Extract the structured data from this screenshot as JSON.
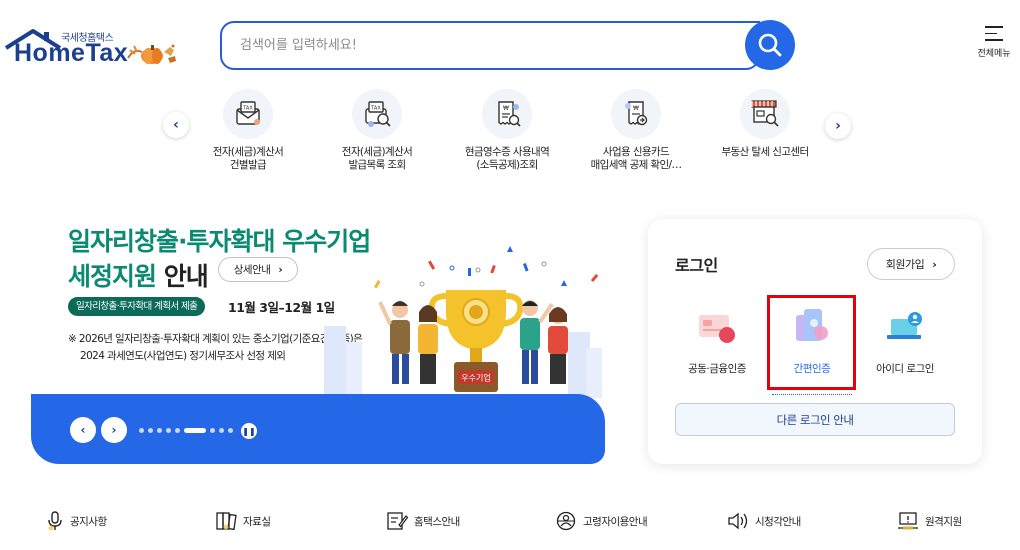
{
  "header": {
    "logo_sub": "국세청홈택스",
    "logo_main": "HomeTax",
    "search_placeholder": "검색어를 입력하세요!",
    "menu_label": "전체메뉴"
  },
  "quick_menu": [
    {
      "label": "전자(세금)계산서\n건별발급",
      "icon": "tax-invoice-envelope-icon"
    },
    {
      "label": "전자(세금)계산서\n발급목록 조회",
      "icon": "tax-invoice-search-icon"
    },
    {
      "label": "현금영수증 사용내역\n(소득공제)조회",
      "icon": "receipt-search-icon"
    },
    {
      "label": "사업용 신용카드\n매입세액 공제 확인/…",
      "icon": "card-receipt-icon"
    },
    {
      "label": "부동산 탈세 신고센터",
      "icon": "store-search-icon"
    }
  ],
  "banner": {
    "title_line1": "일자리창출·투자확대 우수기업",
    "title_line2_green": "세정지원",
    "title_line2_dark": " 안내",
    "detail_button": "상세안내",
    "pill": "일자리창출·투자확대 계획서 제출",
    "period": "11월 3일–12월 1일",
    "note_line1": "※ 2026년 일자리창출·투자확대 계획이 있는 중소기업(기준요건 충족)은",
    "note_line2": "2024 과세연도(사업연도) 정기세무조사 선정 제외",
    "trophy_label": "우수기업",
    "slide_count": 9,
    "active_slide": 6
  },
  "login": {
    "title": "로그인",
    "signup": "회원가입",
    "methods": [
      {
        "label": "공동·금융인증",
        "icon": "certificate-icon"
      },
      {
        "label": "간편인증",
        "icon": "simple-auth-phone-icon",
        "selected": true
      },
      {
        "label": "아이디 로그인",
        "icon": "id-login-laptop-icon"
      }
    ],
    "other_login": "다른 로그인 안내"
  },
  "bottom_nav": [
    {
      "label": "공지사항",
      "icon": "microphone-icon"
    },
    {
      "label": "자료실",
      "icon": "archive-icon"
    },
    {
      "label": "홈택스안내",
      "icon": "document-edit-icon"
    },
    {
      "label": "고령자이용안내",
      "icon": "elderly-guide-icon"
    },
    {
      "label": "시청각안내",
      "icon": "speaker-icon"
    },
    {
      "label": "원격지원",
      "icon": "remote-support-icon"
    }
  ],
  "colors": {
    "brand_blue": "#2468e8",
    "navy": "#1d3f8f",
    "banner_green": "#0a8a72",
    "highlight_red": "#e3000f"
  }
}
